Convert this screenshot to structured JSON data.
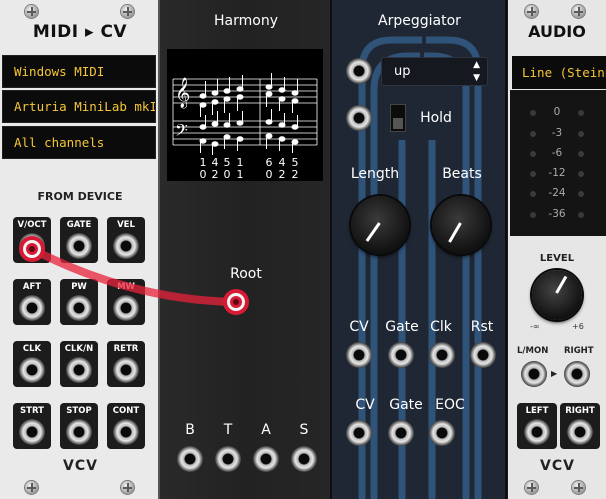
{
  "midi_module": {
    "title": "MIDI ▸ CV",
    "driver": "Windows MIDI",
    "device": "Arturia MiniLab mkII",
    "channel": "All channels",
    "section_label": "FROM DEVICE",
    "outputs": [
      "V/OCT",
      "GATE",
      "VEL",
      "AFT",
      "PW",
      "MW",
      "CLK",
      "CLK/N",
      "RETR",
      "STRT",
      "STOP",
      "CONT"
    ],
    "brand": "VCV"
  },
  "harmony_module": {
    "title": "Harmony",
    "staff_numbers": [
      "1",
      "4",
      "5",
      "1",
      "6",
      "4",
      "5",
      "0",
      "2",
      "0",
      "1",
      "0",
      "2",
      "2"
    ],
    "root_label": "Root",
    "outputs": [
      "B",
      "T",
      "A",
      "S"
    ]
  },
  "arp_module": {
    "title": "Arpeggiator",
    "mode": "up",
    "hold_label": "Hold",
    "knobs": [
      {
        "label": "Length",
        "value": 0.25
      },
      {
        "label": "Beats",
        "value": 0.3
      }
    ],
    "inputs": [
      "CV",
      "Gate",
      "Clk",
      "Rst"
    ],
    "outputs": [
      "CV",
      "Gate",
      "EOC"
    ]
  },
  "audio_module": {
    "title": "AUDIO",
    "device": "Line (Steinberg",
    "meter_labels": [
      "0",
      "-3",
      "-6",
      "-12",
      "-24",
      "-36"
    ],
    "level_label": "LEVEL",
    "level_min": "-∞",
    "level_max": "+6",
    "level_value": 0.7,
    "in_labels": [
      "L/MON",
      "RIGHT"
    ],
    "out_labels": [
      "LEFT",
      "RIGHT"
    ],
    "brand": "VCV"
  },
  "colors": {
    "cable": "#e8223b",
    "lcd_text": "#f5c637"
  }
}
